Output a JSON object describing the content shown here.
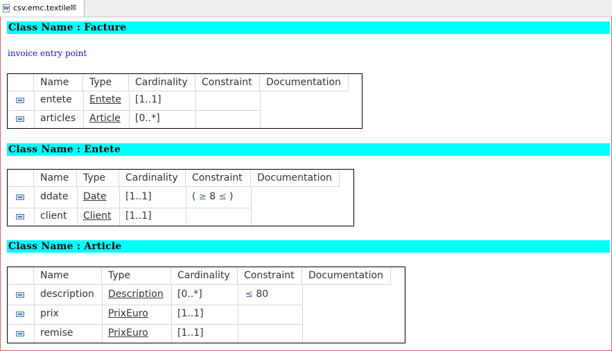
{
  "tab": {
    "label": "csv.emc.textile",
    "icon": "textile-file-icon",
    "close_glyph": "⊠"
  },
  "columns": [
    "Name",
    "Type",
    "Cardinality",
    "Constraint",
    "Documentation"
  ],
  "classes": [
    {
      "header": "Class Name : Facture",
      "description": "invoice entry point",
      "rows": [
        {
          "name": "entete",
          "type": "Entete",
          "cardinality": "[1..1]",
          "constraint": ""
        },
        {
          "name": "articles",
          "type": "Article",
          "cardinality": "[0..*]",
          "constraint": ""
        }
      ]
    },
    {
      "header": "Class Name : Entete",
      "description": "",
      "rows": [
        {
          "name": "ddate",
          "type": "Date",
          "cardinality": "[1..1]",
          "constraint": {
            "open": "(",
            "value": "8",
            "close": ")"
          }
        },
        {
          "name": "client",
          "type": "Client",
          "cardinality": "[1..1]",
          "constraint": ""
        }
      ]
    },
    {
      "header": "Class Name : Article",
      "description": "",
      "rows": [
        {
          "name": "description",
          "type": "Description",
          "cardinality": "[0..*]",
          "constraint": {
            "value": "80"
          }
        },
        {
          "name": "prix",
          "type": "PrixEuro",
          "cardinality": "[1..1]",
          "constraint": ""
        },
        {
          "name": "remise",
          "type": "PrixEuro",
          "cardinality": "[1..1]",
          "constraint": ""
        }
      ]
    }
  ],
  "colors": {
    "class_bar": "#00ffff",
    "description_text": "#1010c8",
    "editor_border": "#e06060"
  }
}
